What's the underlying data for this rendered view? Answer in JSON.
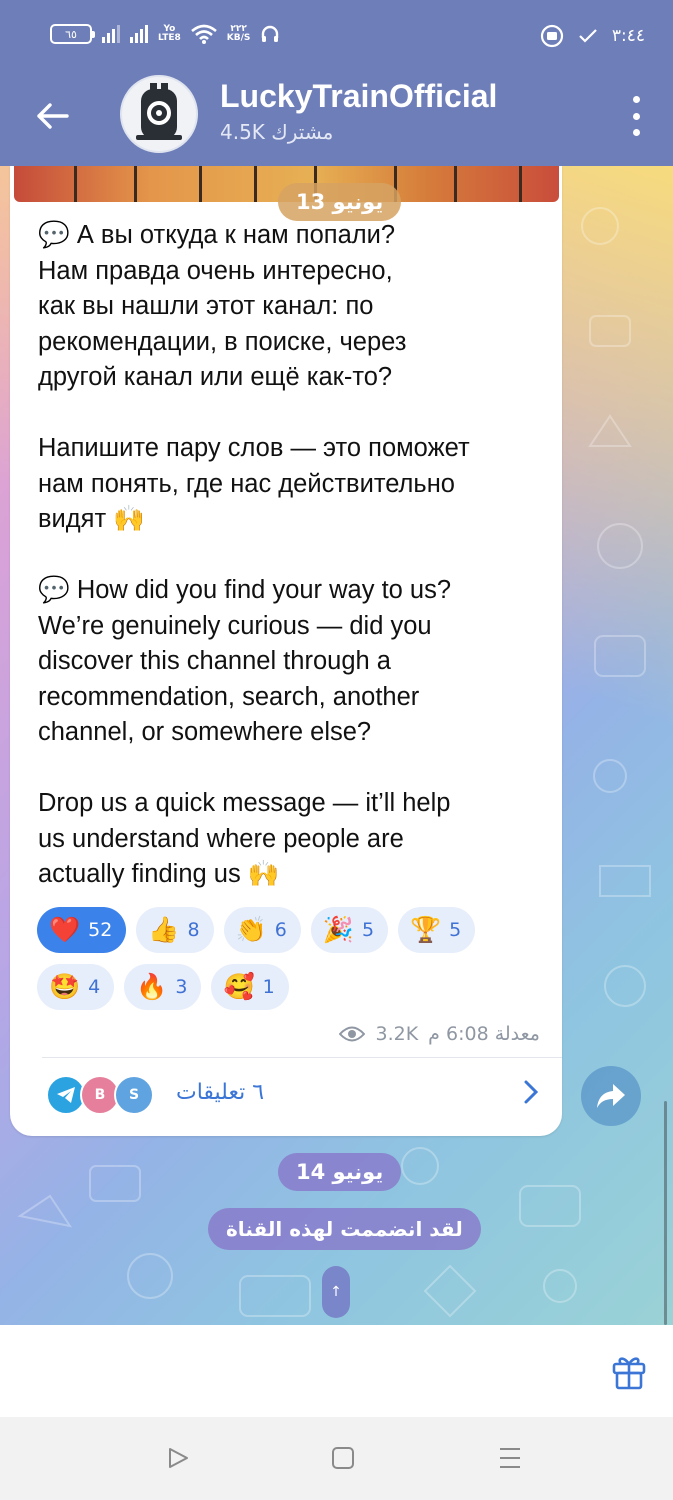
{
  "status_bar": {
    "battery": "٦٥",
    "net_label_1": "Yo",
    "net_label_2": "LTE8",
    "speed_value": "٢٢٢",
    "speed_unit": "KB/S",
    "time": "٣:٤٤"
  },
  "header": {
    "channel_name": "LuckyTrainOfficial",
    "subscribers": "4.5K مشترك"
  },
  "chat": {
    "date_top": "13 يونيو",
    "message_text": "💬 А вы откуда к нам попали?\nНам правда очень интересно,\nкак вы нашли этот канал: по\nрекомендации, в поиске, через\nдругой канал или ещё как-то?\n\nНапишите пару слов — это поможет\nнам понять, где нас действительно\nвидят 🙌\n\n💬 How did you find your way to us?\nWe’re genuinely curious — did you\ndiscover this channel through a\nrecommendation, search, another\nchannel, or somewhere else?\n\nDrop us a quick message — it’ll help\nus understand where people are\nactually finding us 🙌",
    "reactions": [
      {
        "emoji": "❤️",
        "count": "52",
        "active": true
      },
      {
        "emoji": "👍",
        "count": "8",
        "active": false
      },
      {
        "emoji": "👏",
        "count": "6",
        "active": false
      },
      {
        "emoji": "🎉",
        "count": "5",
        "active": false
      },
      {
        "emoji": "🏆",
        "count": "5",
        "active": false
      },
      {
        "emoji": "🤩",
        "count": "4",
        "active": false
      },
      {
        "emoji": "🔥",
        "count": "3",
        "active": false
      },
      {
        "emoji": "🥰",
        "count": "1",
        "active": false
      }
    ],
    "views": "3.2K",
    "time_edited": "معدلة 6:08 م",
    "comment_avatars": [
      "B",
      "S"
    ],
    "comments_label": "٦ تعليقات",
    "date_bottom": "14 يونيو",
    "service_message": "لقد انضممت لهذه القناة"
  },
  "icons": {
    "back": "arrow-left-icon",
    "menu": "more-vertical-icon",
    "share": "share-forward-icon",
    "views": "eye-icon",
    "gift": "gift-icon",
    "comments_arrow": "chevron-right-icon",
    "scroll_down": "arrow-up-icon"
  },
  "colors": {
    "header_bg": "#6e7eb8",
    "accent": "#3b76d6",
    "reaction_active": "#3b82ea",
    "reaction_bg": "#e6edfb"
  }
}
